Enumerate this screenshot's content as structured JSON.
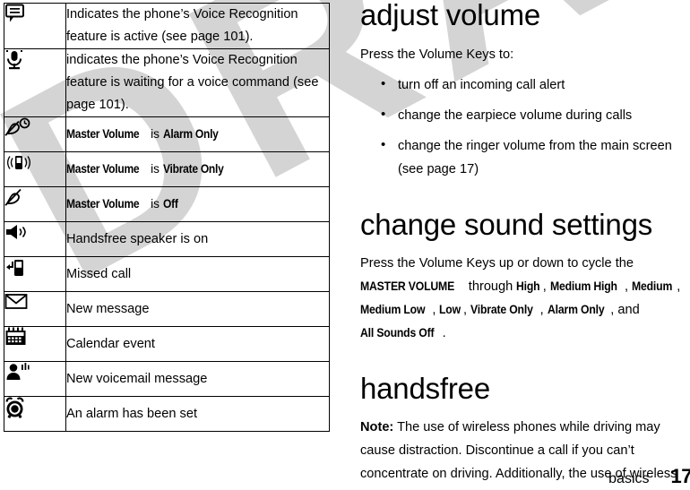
{
  "watermark": {
    "text": "DRAFT"
  },
  "footer": {
    "section": "basics",
    "page": "17"
  },
  "icon_table": {
    "rows": [
      {
        "icon": "speech-bubble-icon",
        "text": "Indicates the phone’s Voice Recognition feature is active (see page 101).",
        "style": "plain"
      },
      {
        "icon": "microphone-icon",
        "text": "indicates the phone’s Voice Recognition feature is waiting for a voice command (see page 101).",
        "style": "plain"
      },
      {
        "icon": "alarm-only-bell-icon",
        "style": "setting",
        "label": "Master Volume",
        "mid": " is ",
        "value": "Alarm Only"
      },
      {
        "icon": "vibrate-only-icon",
        "style": "setting",
        "label": "Master Volume",
        "mid": " is ",
        "value": "Vibrate Only"
      },
      {
        "icon": "bell-off-icon",
        "style": "setting",
        "label": "Master Volume",
        "mid": " is ",
        "value": "Off"
      },
      {
        "icon": "speaker-icon",
        "text": "Handsfree speaker is on",
        "style": "plain"
      },
      {
        "icon": "missed-call-icon",
        "text": "Missed call",
        "style": "plain"
      },
      {
        "icon": "envelope-icon",
        "text": "New message",
        "style": "plain"
      },
      {
        "icon": "calendar-icon",
        "text": "Calendar event",
        "style": "plain"
      },
      {
        "icon": "voicemail-icon",
        "text": "New voicemail message",
        "style": "plain"
      },
      {
        "icon": "alarm-clock-icon",
        "text": "An alarm has been set",
        "style": "plain"
      }
    ]
  },
  "right": {
    "adjust_volume": {
      "heading": "adjust volume",
      "intro": "Press the Volume Keys to:",
      "bullets": [
        "turn off an incoming call alert",
        "change the earpiece volume during calls",
        "change the ringer volume from the main screen (see page 17)"
      ]
    },
    "change_sound_settings": {
      "heading": "change sound settings",
      "para_pre": "Press the Volume Keys up or down to cycle the ",
      "master_volume": "MASTER VOLUME",
      "para_mid": " through ",
      "values": [
        "High",
        "Medium High",
        "Medium",
        "Medium Low",
        "Low",
        "Vibrate Only",
        "Alarm Only"
      ],
      "para_and": " and ",
      "last_value": "All Sounds Off",
      "para_end": "."
    },
    "handsfree": {
      "heading": "handsfree",
      "note_label": "Note:",
      "note_text": " The use of wireless phones while driving may cause distraction. Discontinue a call if you can’t concentrate on driving. Additionally, the use of wireless"
    }
  }
}
